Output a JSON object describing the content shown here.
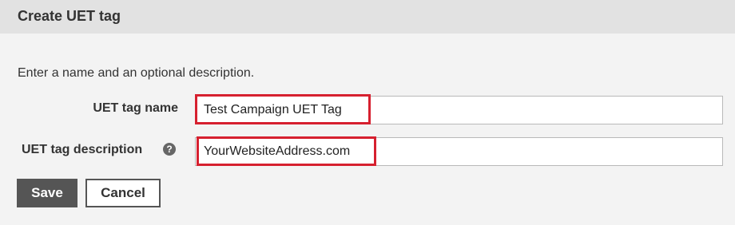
{
  "header": {
    "title": "Create UET tag"
  },
  "form": {
    "instructions": "Enter a name and an optional description.",
    "name_label": "UET tag name",
    "name_value": "Test Campaign UET Tag",
    "description_label": "UET tag description",
    "description_value": "YourWebsiteAddress.com",
    "help_glyph": "?"
  },
  "actions": {
    "save_label": "Save",
    "cancel_label": "Cancel"
  },
  "colors": {
    "highlight": "#d6202f",
    "header_bg": "#e2e2e2",
    "page_bg": "#f3f3f3",
    "save_bg": "#555555"
  },
  "icons": {
    "help": "help-circle-icon"
  }
}
